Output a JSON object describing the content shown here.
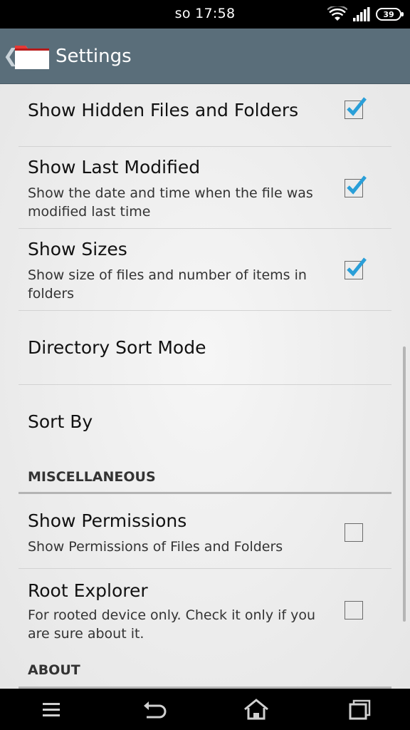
{
  "status": {
    "time": "so 17:58",
    "battery": "39"
  },
  "actionbar": {
    "title": "Settings",
    "back_glyph": "❮",
    "app_icon": "folder-icon"
  },
  "prefs": [
    {
      "title": "Show Hidden Files and Folders",
      "summary": "",
      "checked": true
    },
    {
      "title": "Show Last Modified",
      "summary": "Show the date and time when the file was modified last time",
      "checked": true
    },
    {
      "title": "Show Sizes",
      "summary": "Show size of files and number of items in folders",
      "checked": true
    },
    {
      "title": "Directory Sort Mode",
      "summary": ""
    },
    {
      "title": "Sort By",
      "summary": ""
    }
  ],
  "misc": {
    "category": "MISCELLANEOUS",
    "prefs": [
      {
        "title": "Show Permissions",
        "summary": "Show Permissions of Files and Folders",
        "checked": false
      },
      {
        "title": "Root Explorer",
        "summary": "For rooted device only. Check it only if you are sure about it.",
        "checked": false
      }
    ]
  },
  "about": {
    "category": "ABOUT"
  },
  "nav": {
    "menu": "menu-icon",
    "back": "back-icon",
    "home": "home-icon",
    "recents": "recents-icon"
  },
  "colors": {
    "actionbar": "#5a6e7a",
    "checkmark": "#2a9fd8"
  }
}
